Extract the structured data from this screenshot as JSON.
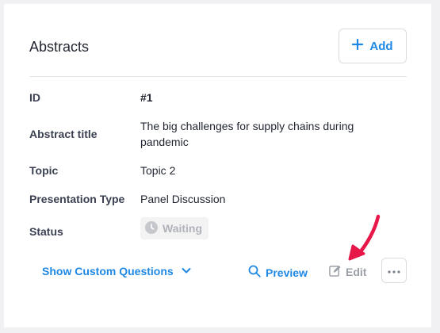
{
  "header": {
    "title": "Abstracts",
    "add_label": "Add"
  },
  "fields": [
    {
      "label": "ID",
      "value": "#1"
    },
    {
      "label": "Abstract title",
      "value": "The big challenges for supply chains during pandemic"
    },
    {
      "label": "Topic",
      "value": "Topic 2"
    },
    {
      "label": "Presentation Type",
      "value": "Panel Discussion"
    },
    {
      "label": "Status",
      "value": "Waiting"
    }
  ],
  "actions": {
    "show_custom_label": "Show Custom Questions",
    "preview_label": "Preview",
    "edit_label": "Edit"
  },
  "colors": {
    "accent": "#1e88e5",
    "annotation": "#e8174a",
    "muted": "#9a9ea6"
  },
  "icons": {
    "add": "plus-icon",
    "status": "clock-icon",
    "show_custom": "chevron-down-icon",
    "preview": "search-icon",
    "edit": "pencil-icon",
    "more": "more-horizontal-icon",
    "annotation": "red-arrow-annotation"
  }
}
